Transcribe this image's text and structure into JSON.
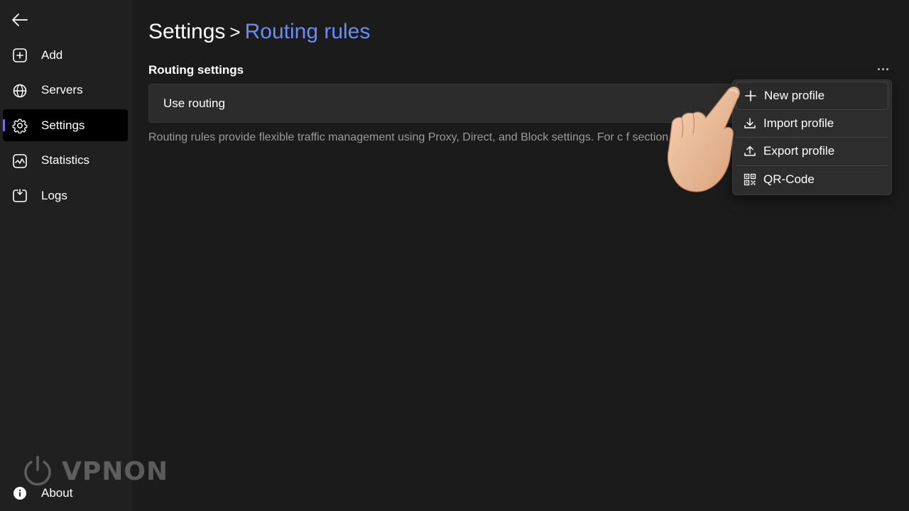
{
  "sidebar": {
    "items": [
      {
        "label": "Add",
        "icon": "add-box-icon"
      },
      {
        "label": "Servers",
        "icon": "globe-icon"
      },
      {
        "label": "Settings",
        "icon": "gear-icon",
        "active": true
      },
      {
        "label": "Statistics",
        "icon": "chart-icon"
      },
      {
        "label": "Logs",
        "icon": "logs-icon"
      }
    ],
    "about_label": "About",
    "watermark": "VPNON"
  },
  "header": {
    "root": "Settings",
    "separator": ">",
    "current": "Routing rules"
  },
  "section": {
    "title": "Routing settings",
    "card_label": "Use routing",
    "description": "Routing rules provide flexible traffic management using Proxy, Direct, and Block settings. For c                          f section."
  },
  "menu": {
    "items": [
      {
        "label": "New profile",
        "icon": "plus-icon"
      },
      {
        "label": "Import profile",
        "icon": "download-icon"
      },
      {
        "label": "Export profile",
        "icon": "upload-icon"
      },
      {
        "label": "QR-Code",
        "icon": "qr-code-icon"
      }
    ]
  },
  "colors": {
    "accent": "#6a8cf7",
    "active_indicator": "#7b6cf6",
    "background": "#1b1b1b",
    "sidebar": "#202020"
  }
}
